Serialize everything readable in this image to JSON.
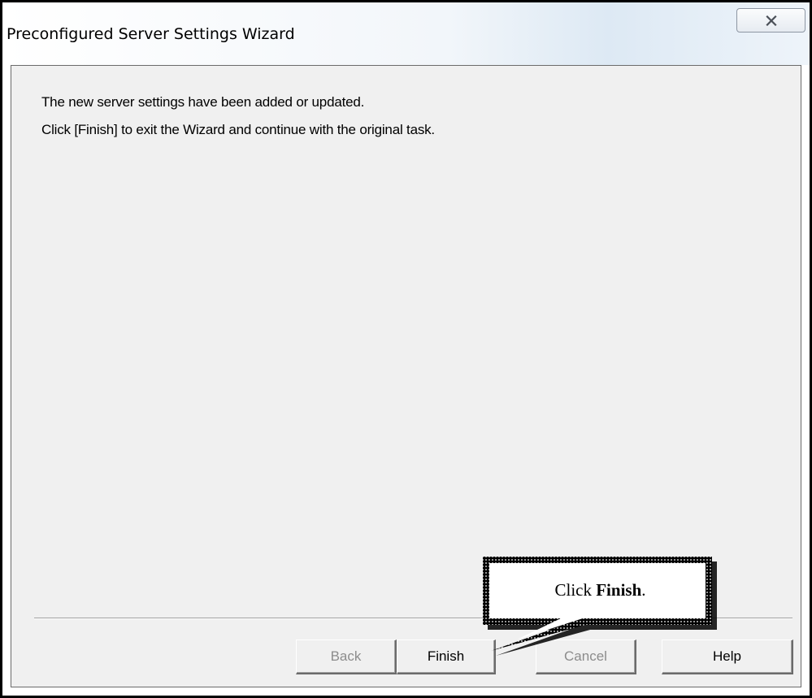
{
  "window": {
    "title": "Preconfigured Server Settings Wizard",
    "close_icon": "close-icon"
  },
  "content": {
    "line1": "The new server settings have been added or updated.",
    "line2": "Click [Finish] to exit the Wizard and continue with the original task."
  },
  "buttons": {
    "back": "Back",
    "finish": "Finish",
    "cancel": "Cancel",
    "help": "Help"
  },
  "callout": {
    "prefix": "Click ",
    "emphasis": "Finish",
    "suffix": "."
  },
  "colors": {
    "dialog_background": "#f0f0f0",
    "disabled_text": "#8c8c8c"
  }
}
